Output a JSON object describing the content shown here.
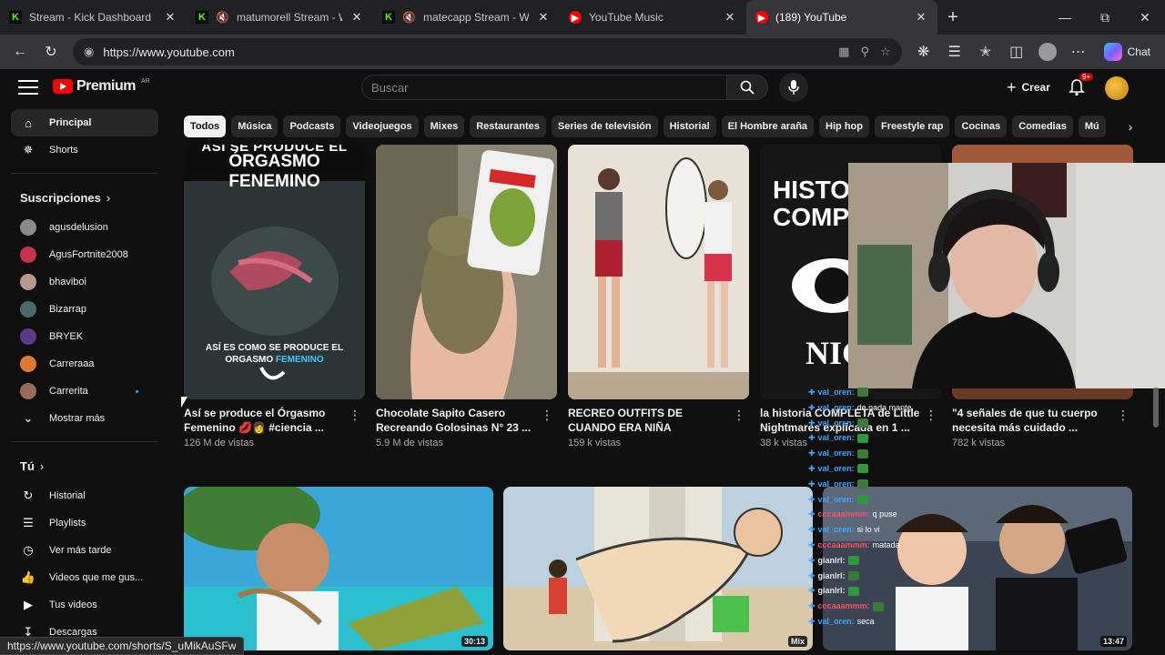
{
  "browser": {
    "tabs": [
      {
        "title": "Stream - Kick Dashboard",
        "icon": "kick-icon",
        "color": "#53fc18",
        "muted": false
      },
      {
        "title": "matumorell Stream - Watc",
        "icon": "kick-icon",
        "color": "#53fc18",
        "muted": true
      },
      {
        "title": "matecapp Stream - Watch",
        "icon": "kick-icon",
        "color": "#53fc18",
        "muted": true
      },
      {
        "title": "YouTube Music",
        "icon": "youtube-music-icon",
        "color": "#ff0000",
        "muted": false
      },
      {
        "title": "(189) YouTube",
        "icon": "youtube-icon",
        "color": "#ff0000",
        "muted": false,
        "active": true
      }
    ],
    "url": "https://www.youtube.com",
    "chat_label": "Chat",
    "status_url": "https://www.youtube.com/shorts/S_uMikAuSFw"
  },
  "youtube": {
    "logo_text": "Premium",
    "logo_region": "AR",
    "search_placeholder": "Buscar",
    "create_label": "Crear",
    "notif_badge": "9+",
    "chips": [
      "Todos",
      "Música",
      "Podcasts",
      "Videojuegos",
      "Mixes",
      "Restaurantes",
      "Series de televisión",
      "Historial",
      "El Hombre araña",
      "Hip hop",
      "Freestyle rap",
      "Cocinas",
      "Comedias",
      "Mú"
    ],
    "sidebar": {
      "main": [
        {
          "label": "Principal",
          "icon": "home-icon",
          "active": true
        },
        {
          "label": "Shorts",
          "icon": "shorts-icon"
        }
      ],
      "subs_title": "Suscripciones",
      "subs": [
        {
          "label": "agusdelusion",
          "color": "#8a8a8a"
        },
        {
          "label": "AgusFortnite2008",
          "color": "#c8324a"
        },
        {
          "label": "bhaviboi",
          "color": "#b89a8a"
        },
        {
          "label": "Bizarrap",
          "color": "#4a6a6a"
        },
        {
          "label": "BRYEK",
          "color": "#5a3a8a"
        },
        {
          "label": "Carreraaa",
          "color": "#e07a2a"
        },
        {
          "label": "Carrerita",
          "color": "#9a6a5a",
          "live": true
        }
      ],
      "show_more": "Mostrar más",
      "you_title": "Tú",
      "you": [
        {
          "label": "Historial",
          "icon": "history-icon"
        },
        {
          "label": "Playlists",
          "icon": "playlist-icon"
        },
        {
          "label": "Ver más tarde",
          "icon": "clock-icon"
        },
        {
          "label": "Videos que me gus...",
          "icon": "thumbs-up-icon"
        },
        {
          "label": "Tus videos",
          "icon": "video-icon"
        },
        {
          "label": "Descargas",
          "icon": "download-icon"
        }
      ]
    },
    "shorts": [
      {
        "title": "Así se produce el Órgasmo Femenino 💋👩 #ciencia ...",
        "views": "126 M de vistas",
        "overlay_top": "ÓRGASMO FENEMINO",
        "overlay_top_partial": "ASÍ SE PRODUCE EL",
        "overlay_bottom": "ASÍ ES COMO SE PRODUCE EL",
        "overlay_bottom2": "ORGASMO",
        "overlay_bottom3": "FEMENINO",
        "bg": "#2a3436"
      },
      {
        "title": "Chocolate Sapito Casero Recreando Golosinas N° 23 ...",
        "views": "5.9 M de vistas",
        "bg": "#7a7560"
      },
      {
        "title": "RECREO OUTFITS DE CUANDO ERA NIÑA",
        "views": "159 k vistas",
        "bg": "#c9c2b8"
      },
      {
        "title": "la historia COMPLETA de Little Nightmares explicada en 1 ...",
        "views": "38 k vistas",
        "overlay_big1": "HISTO",
        "overlay_big2": "COMP",
        "overlay_big3": "NIGHT",
        "bg": "#1c1c1c"
      },
      {
        "title": "\"4 señales de que tu cuerpo necesita más cuidado ...",
        "views": "782 k vistas",
        "bg": "#5a3020"
      }
    ],
    "videos": [
      {
        "duration": "30:13",
        "bg": "#2a9ac0"
      },
      {
        "duration": "Mix",
        "bg": "#c4b8a0"
      },
      {
        "duration": "13:47",
        "bg": "#3a4a5a"
      }
    ]
  },
  "chat_overlay": [
    {
      "user": "val_oren:",
      "msg": "",
      "color": "#3ea6ff"
    },
    {
      "user": "val_oren:",
      "msg": "de nada mante",
      "color": "#3ea6ff"
    },
    {
      "user": "val_oren:",
      "msg": "",
      "color": "#3ea6ff"
    },
    {
      "user": "val_oren:",
      "msg": "",
      "color": "#3ea6ff"
    },
    {
      "user": "val_oren:",
      "msg": "",
      "color": "#3ea6ff"
    },
    {
      "user": "val_oren:",
      "msg": "",
      "color": "#3ea6ff"
    },
    {
      "user": "val_oren:",
      "msg": "",
      "color": "#3ea6ff"
    },
    {
      "user": "val_oren:",
      "msg": "",
      "color": "#3ea6ff"
    },
    {
      "user": "cccaaammm:",
      "msg": "q puse",
      "color": "#ff4d6d"
    },
    {
      "user": "val_oren:",
      "msg": "si lo vi",
      "color": "#3ea6ff"
    },
    {
      "user": "cccaaammm:",
      "msg": "matada",
      "color": "#ff4d6d"
    },
    {
      "user": "gianlrl:",
      "msg": "",
      "color": "#e8e8e8"
    },
    {
      "user": "gianlrl:",
      "msg": "",
      "color": "#e8e8e8"
    },
    {
      "user": "gianlrl:",
      "msg": "",
      "color": "#e8e8e8"
    },
    {
      "user": "cccaaammm:",
      "msg": "",
      "color": "#ff4d6d"
    },
    {
      "user": "val_oren:",
      "msg": "seca",
      "color": "#3ea6ff"
    }
  ]
}
